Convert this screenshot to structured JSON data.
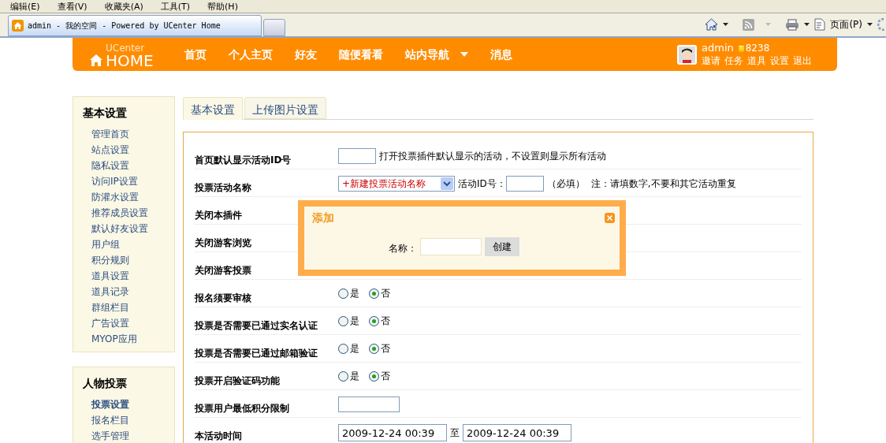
{
  "browser": {
    "menu": [
      "编辑(E)",
      "查看(V)",
      "收藏夹(A)",
      "工具(T)",
      "帮助(H)"
    ],
    "tab_title": "admin - 我的空间 - Powered by UCenter Home",
    "page_menu": "页面(P)"
  },
  "header": {
    "logo_top": "UCenter",
    "logo_bottom": "HOME",
    "nav": [
      "首页",
      "个人主页",
      "好友",
      "随便看看",
      "站内导航",
      "消息"
    ],
    "user": "admin",
    "credits": "8238",
    "user_links": [
      "邀请",
      "任务",
      "道具",
      "设置",
      "退出"
    ]
  },
  "sidebar": [
    {
      "title": "基本设置",
      "items": [
        {
          "label": "管理首页",
          "selected": false
        },
        {
          "label": "站点设置",
          "selected": false
        },
        {
          "label": "隐私设置",
          "selected": false
        },
        {
          "label": "访问IP设置",
          "selected": false
        },
        {
          "label": "防灌水设置",
          "selected": false
        },
        {
          "label": "推荐成员设置",
          "selected": false
        },
        {
          "label": "默认好友设置",
          "selected": false
        },
        {
          "label": "用户组",
          "selected": false
        },
        {
          "label": "积分规则",
          "selected": false
        },
        {
          "label": "道具设置",
          "selected": false
        },
        {
          "label": "道具记录",
          "selected": false
        },
        {
          "label": "群组栏目",
          "selected": false
        },
        {
          "label": "广告设置",
          "selected": false
        },
        {
          "label": "MYOP应用",
          "selected": false
        }
      ]
    },
    {
      "title": "人物投票",
      "items": [
        {
          "label": "投票设置",
          "selected": true
        },
        {
          "label": "报名栏目",
          "selected": false
        },
        {
          "label": "选手管理",
          "selected": false
        }
      ]
    }
  ],
  "tabs": [
    {
      "label": "基本设置",
      "selected": true
    },
    {
      "label": "上传图片设置",
      "selected": false
    }
  ],
  "form": [
    {
      "kind": "input_note",
      "label": "首页默认显示活动ID号",
      "note": "打开投票插件默认显示的活动，不设置则显示所有活动"
    },
    {
      "kind": "select_id",
      "label": "投票活动名称",
      "select_value": "+新建投票活动名称",
      "id_label": "活动ID号：",
      "required": "（必填）",
      "note": "注：请填数字,不要和其它活动重复"
    },
    {
      "kind": "covered",
      "label": "关闭本插件"
    },
    {
      "kind": "covered",
      "label": "关闭游客浏览"
    },
    {
      "kind": "covered",
      "label": "关闭游客投票"
    },
    {
      "kind": "radio",
      "label": "报名须要审核",
      "options": [
        {
          "label": "是",
          "selected": false
        },
        {
          "label": "否",
          "selected": true
        }
      ]
    },
    {
      "kind": "radio",
      "label": "投票是否需要已通过实名认证",
      "options": [
        {
          "label": "是",
          "selected": false
        },
        {
          "label": "否",
          "selected": true
        }
      ]
    },
    {
      "kind": "radio",
      "label": "投票是否需要已通过邮箱验证",
      "options": [
        {
          "label": "是",
          "selected": false
        },
        {
          "label": "否",
          "selected": true
        }
      ]
    },
    {
      "kind": "radio",
      "label": "投票开启验证码功能",
      "options": [
        {
          "label": "是",
          "selected": false
        },
        {
          "label": "否",
          "selected": true
        }
      ]
    },
    {
      "kind": "input",
      "label": "投票用户最低积分限制"
    },
    {
      "kind": "range",
      "label": "本活动时间",
      "from": "2009-12-24 00:39",
      "to_label": "至",
      "to": "2009-12-24 00:39"
    }
  ],
  "dialog": {
    "title": "添加",
    "field_label": "名称：",
    "button": "创建"
  }
}
